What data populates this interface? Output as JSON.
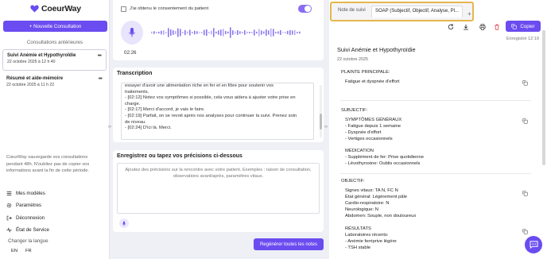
{
  "brand": {
    "name": "CoeurWay",
    "color": "#6a4cf0"
  },
  "sidebar": {
    "new_consultation": "+ Nouvelle Consultation",
    "previous_title": "Consultations antérieures",
    "consultations": [
      {
        "title": "Suivi Anémie et Hypothyroïdie",
        "date": "22 octobre 2025 à 12 h 40",
        "menu": "•••"
      },
      {
        "title": "Résumé et aide-mémoire",
        "date": "22 octobre 2025 à 11 h 22",
        "menu": "•••"
      }
    ],
    "save_note": "CœurWay sauvegarde vos consultations pendant 48h. N'oubliez pas de copier vos informations avant la fin de cette période.",
    "links": [
      {
        "label": "Mes modèles",
        "icon": "list-icon"
      },
      {
        "label": "Paramètres",
        "icon": "gear-icon"
      },
      {
        "label": "Déconnexion",
        "icon": "logout-icon"
      },
      {
        "label": "État de Service",
        "icon": "pulse-icon"
      }
    ],
    "change_language": "Changer la langue",
    "languages": [
      "EN",
      "FR"
    ]
  },
  "recording": {
    "consent_label": "J'ai obtenu le consentement du patient",
    "consent_toggle_on": true,
    "timer": "02:26"
  },
  "transcription": {
    "title": "Transcription",
    "lines": [
      "essayer d'avoir une alimentation riche en fer et en fibre pour soutenir vos",
      "traitements.",
      "- [02:12] Notez vos symptômes si possible, cela vous aidera à ajuster votre prise en",
      "charge.",
      "- [02:17] Merci d'accord, je vais le faire.",
      "- [02:19] Parfait, on se revoit après nos analyses pour continuer la suivi. Prenez soin",
      "de niveau.",
      "- [02:24] D'ici là. Merci."
    ]
  },
  "precisions": {
    "title": "Enregistrez ou tapez vos précisions ci-dessous",
    "placeholder": "Ajoutez des précisions sur la rencontre avec votre patient. Exemples : raison de consultation, observations avant/après, paramètres vitaux.",
    "regenerate": "Regénérer toutes les notes"
  },
  "note_panel": {
    "tabs": [
      "Note de suivi",
      "SOAP (Subjectif, Objectif, Analyse, Pl..."
    ],
    "add_tab": "+",
    "copy_label": "Copier",
    "saved_label": "Enregistré 12:19",
    "title": "Suivi Anémie et Hypothyroïdie",
    "date": "22 octobre 2025",
    "sections": {
      "complaint_head": "PLAINTE PRINCIPALE:",
      "complaint_text": "Fatigue et dyspnée d'effort",
      "subjective_head": "SUBJECTIF:",
      "symptoms_head": "SYMPTÔMES GÉNÉRAUX",
      "symptoms": [
        "- Fatigue depuis 1 semaine",
        "- Dyspnée d'effort",
        "- Vertiges occasionnels"
      ],
      "medication_head": "MÉDICATION",
      "medication": [
        "- Supplément de fer: Prise quotidienne",
        "- Lévothyroxine: Oublis occasionnels"
      ],
      "objective_head": "OBJECTIF:",
      "objective": [
        "Signes vitaux: TA N, FC N",
        "État général: Légèrement pâle",
        "Cardio-respiratoire: N",
        "Neurologique: N",
        "Abdomen: Souple, non douloureux"
      ],
      "results_head": "RÉSULTATS",
      "results": [
        "Laboratoires récents:",
        "- Anémie ferriprive légère",
        "- TSH stable"
      ]
    }
  }
}
